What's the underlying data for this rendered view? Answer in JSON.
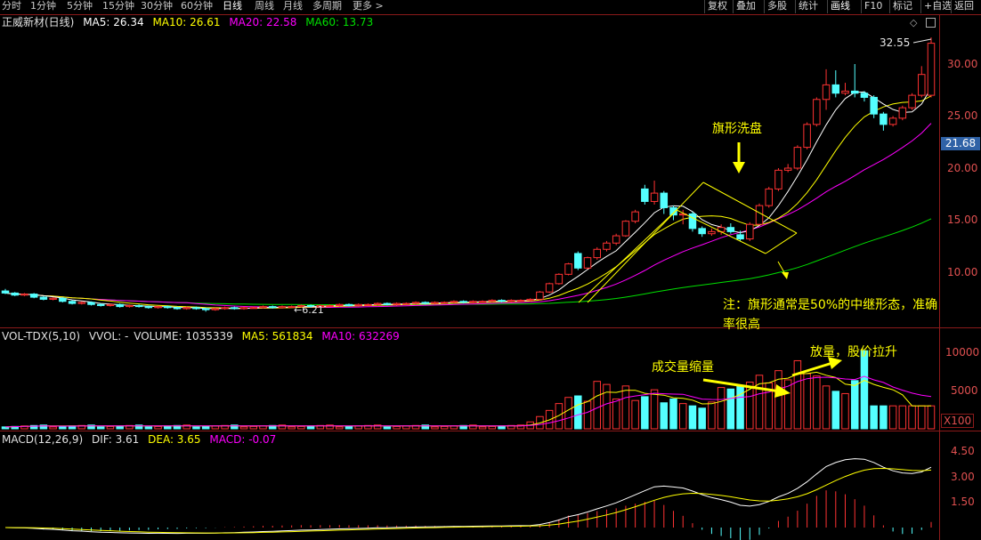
{
  "toolbar": {
    "periods": [
      "分时",
      "1分钟",
      "5分钟",
      "15分钟",
      "30分钟",
      "60分钟",
      "日线",
      "周线",
      "月线",
      "多周期",
      "更多 >"
    ],
    "active_period": "日线",
    "right_buttons": [
      "复权",
      "叠加",
      "多股",
      "统计",
      "画线",
      "F10",
      "标记",
      "+自选",
      "返回"
    ],
    "active_right": "画线"
  },
  "main_legend": {
    "title": "正威新材(日线)",
    "ma5": "MA5: 26.34",
    "ma10": "MA10: 26.61",
    "ma20": "MA20: 22.58",
    "ma60": "MA60: 13.73"
  },
  "price_axis": {
    "ticks": [
      "30.00",
      "25.00",
      "20.00",
      "15.00",
      "10.00"
    ],
    "current_price": "21.68",
    "high_label": "32.55",
    "low_label": "6.21"
  },
  "vol_legend": {
    "title": "VOL-TDX(5,10)",
    "vvol": "VVOL: -",
    "volume": "VOLUME: 1035339",
    "ma5": "MA5: 561834",
    "ma10": "MA10: 632269"
  },
  "vol_axis": {
    "ticks": [
      "10000",
      "5000"
    ],
    "unit": "X100"
  },
  "macd_legend": {
    "title": "MACD(12,26,9)",
    "dif": "DIF: 3.61",
    "dea": "DEA: 3.65",
    "macd": "MACD: -0.07"
  },
  "macd_axis": {
    "ticks": [
      "4.50",
      "3.00",
      "1.50"
    ]
  },
  "annotations": {
    "flag_wash": "旗形洗盘",
    "note_line1": "注：旗形通常是50%的中继形态，准确",
    "note_line2": "率很高",
    "volume_shrink": "成交量缩量",
    "volume_up": "放量，股价拉升"
  },
  "colors": {
    "up": "#ff3232",
    "down": "#54ffff",
    "ma5": "#ffffff",
    "ma10": "#ffff00",
    "ma20": "#ff00ff",
    "ma60": "#00e000",
    "annotation": "#ffff00"
  },
  "chart_data": {
    "type": "candlestick",
    "price_ylim": [
      5,
      33
    ],
    "candles": [
      {
        "o": 8.2,
        "c": 8.0,
        "h": 8.4,
        "l": 7.9
      },
      {
        "o": 8.0,
        "c": 7.8,
        "h": 8.1,
        "l": 7.7
      },
      {
        "o": 7.8,
        "c": 7.9,
        "h": 8.0,
        "l": 7.7
      },
      {
        "o": 7.9,
        "c": 7.6,
        "h": 8.0,
        "l": 7.5
      },
      {
        "o": 7.6,
        "c": 7.4,
        "h": 7.7,
        "l": 7.3
      },
      {
        "o": 7.4,
        "c": 7.5,
        "h": 7.6,
        "l": 7.3
      },
      {
        "o": 7.5,
        "c": 7.2,
        "h": 7.6,
        "l": 7.1
      },
      {
        "o": 7.2,
        "c": 7.0,
        "h": 7.3,
        "l": 6.9
      },
      {
        "o": 7.0,
        "c": 7.1,
        "h": 7.2,
        "l": 6.9
      },
      {
        "o": 7.1,
        "c": 6.9,
        "h": 7.2,
        "l": 6.8
      },
      {
        "o": 6.9,
        "c": 6.8,
        "h": 7.0,
        "l": 6.7
      },
      {
        "o": 6.8,
        "c": 6.9,
        "h": 7.0,
        "l": 6.7
      },
      {
        "o": 6.9,
        "c": 6.7,
        "h": 7.0,
        "l": 6.6
      },
      {
        "o": 6.7,
        "c": 6.8,
        "h": 6.9,
        "l": 6.6
      },
      {
        "o": 6.8,
        "c": 6.7,
        "h": 6.9,
        "l": 6.6
      },
      {
        "o": 6.7,
        "c": 6.6,
        "h": 6.8,
        "l": 6.5
      },
      {
        "o": 6.6,
        "c": 6.7,
        "h": 6.8,
        "l": 6.5
      },
      {
        "o": 6.7,
        "c": 6.6,
        "h": 6.8,
        "l": 6.5
      },
      {
        "o": 6.6,
        "c": 6.5,
        "h": 6.7,
        "l": 6.4
      },
      {
        "o": 6.5,
        "c": 6.6,
        "h": 6.7,
        "l": 6.4
      },
      {
        "o": 6.6,
        "c": 6.5,
        "h": 6.7,
        "l": 6.4
      },
      {
        "o": 6.5,
        "c": 6.4,
        "h": 6.6,
        "l": 6.21
      },
      {
        "o": 6.4,
        "c": 6.5,
        "h": 6.6,
        "l": 6.3
      },
      {
        "o": 6.5,
        "c": 6.6,
        "h": 6.7,
        "l": 6.4
      },
      {
        "o": 6.6,
        "c": 6.5,
        "h": 6.7,
        "l": 6.4
      },
      {
        "o": 6.5,
        "c": 6.6,
        "h": 6.7,
        "l": 6.4
      },
      {
        "o": 6.6,
        "c": 6.6,
        "h": 6.7,
        "l": 6.5
      },
      {
        "o": 6.6,
        "c": 6.7,
        "h": 6.8,
        "l": 6.5
      },
      {
        "o": 6.7,
        "c": 6.6,
        "h": 6.8,
        "l": 6.5
      },
      {
        "o": 6.6,
        "c": 6.7,
        "h": 6.8,
        "l": 6.5
      },
      {
        "o": 6.7,
        "c": 6.7,
        "h": 6.8,
        "l": 6.6
      },
      {
        "o": 6.7,
        "c": 6.8,
        "h": 6.9,
        "l": 6.6
      },
      {
        "o": 6.8,
        "c": 6.7,
        "h": 6.9,
        "l": 6.6
      },
      {
        "o": 6.7,
        "c": 6.8,
        "h": 6.9,
        "l": 6.6
      },
      {
        "o": 6.8,
        "c": 6.8,
        "h": 6.9,
        "l": 6.7
      },
      {
        "o": 6.8,
        "c": 6.9,
        "h": 7.0,
        "l": 6.7
      },
      {
        "o": 6.9,
        "c": 6.8,
        "h": 7.0,
        "l": 6.7
      },
      {
        "o": 6.8,
        "c": 6.9,
        "h": 7.0,
        "l": 6.7
      },
      {
        "o": 6.9,
        "c": 6.9,
        "h": 7.0,
        "l": 6.8
      },
      {
        "o": 6.9,
        "c": 7.0,
        "h": 7.1,
        "l": 6.8
      },
      {
        "o": 7.0,
        "c": 6.9,
        "h": 7.1,
        "l": 6.8
      },
      {
        "o": 6.9,
        "c": 7.0,
        "h": 7.1,
        "l": 6.8
      },
      {
        "o": 7.0,
        "c": 7.0,
        "h": 7.1,
        "l": 6.9
      },
      {
        "o": 7.0,
        "c": 7.1,
        "h": 7.2,
        "l": 6.9
      },
      {
        "o": 7.1,
        "c": 7.0,
        "h": 7.2,
        "l": 6.9
      },
      {
        "o": 7.0,
        "c": 7.1,
        "h": 7.2,
        "l": 6.9
      },
      {
        "o": 7.1,
        "c": 7.1,
        "h": 7.2,
        "l": 7.0
      },
      {
        "o": 7.1,
        "c": 7.2,
        "h": 7.3,
        "l": 7.0
      },
      {
        "o": 7.2,
        "c": 7.1,
        "h": 7.3,
        "l": 7.0
      },
      {
        "o": 7.1,
        "c": 7.2,
        "h": 7.3,
        "l": 7.0
      },
      {
        "o": 7.2,
        "c": 7.2,
        "h": 7.3,
        "l": 7.1
      },
      {
        "o": 7.2,
        "c": 7.3,
        "h": 7.4,
        "l": 7.1
      },
      {
        "o": 7.3,
        "c": 7.2,
        "h": 7.4,
        "l": 7.1
      },
      {
        "o": 7.2,
        "c": 7.3,
        "h": 7.4,
        "l": 7.1
      },
      {
        "o": 7.3,
        "c": 7.3,
        "h": 7.4,
        "l": 7.2
      },
      {
        "o": 7.3,
        "c": 7.4,
        "h": 7.5,
        "l": 7.2
      },
      {
        "o": 7.4,
        "c": 8.1,
        "h": 8.2,
        "l": 7.3
      },
      {
        "o": 8.1,
        "c": 8.9,
        "h": 9.0,
        "l": 8.0
      },
      {
        "o": 8.9,
        "c": 9.8,
        "h": 9.9,
        "l": 8.8
      },
      {
        "o": 9.8,
        "c": 10.8,
        "h": 10.9,
        "l": 9.7
      },
      {
        "o": 11.8,
        "c": 10.4,
        "h": 12.0,
        "l": 10.2
      },
      {
        "o": 10.4,
        "c": 11.4,
        "h": 11.5,
        "l": 10.3
      },
      {
        "o": 11.4,
        "c": 12.2,
        "h": 12.4,
        "l": 11.2
      },
      {
        "o": 12.2,
        "c": 12.8,
        "h": 13.0,
        "l": 12.0
      },
      {
        "o": 12.8,
        "c": 13.5,
        "h": 13.7,
        "l": 12.6
      },
      {
        "o": 13.5,
        "c": 14.9,
        "h": 15.0,
        "l": 13.4
      },
      {
        "o": 14.9,
        "c": 15.8,
        "h": 16.0,
        "l": 14.7
      },
      {
        "o": 18.0,
        "c": 16.8,
        "h": 18.4,
        "l": 16.5
      },
      {
        "o": 16.8,
        "c": 17.6,
        "h": 18.8,
        "l": 16.5
      },
      {
        "o": 17.6,
        "c": 16.2,
        "h": 17.8,
        "l": 15.6
      },
      {
        "o": 16.2,
        "c": 15.5,
        "h": 16.4,
        "l": 15.0
      },
      {
        "o": 15.5,
        "c": 15.6,
        "h": 16.0,
        "l": 14.6
      },
      {
        "o": 15.6,
        "c": 14.2,
        "h": 15.8,
        "l": 13.9
      },
      {
        "o": 14.2,
        "c": 13.7,
        "h": 14.4,
        "l": 13.4
      },
      {
        "o": 13.7,
        "c": 13.9,
        "h": 14.2,
        "l": 13.5
      },
      {
        "o": 13.9,
        "c": 14.3,
        "h": 14.6,
        "l": 13.6
      },
      {
        "o": 14.3,
        "c": 13.9,
        "h": 14.7,
        "l": 13.7
      },
      {
        "o": 13.6,
        "c": 13.2,
        "h": 14.0,
        "l": 13.0
      },
      {
        "o": 13.2,
        "c": 14.6,
        "h": 14.8,
        "l": 13.0
      },
      {
        "o": 14.6,
        "c": 16.4,
        "h": 16.6,
        "l": 14.5
      },
      {
        "o": 16.4,
        "c": 18.0,
        "h": 18.2,
        "l": 16.2
      },
      {
        "o": 18.0,
        "c": 19.8,
        "h": 20.0,
        "l": 17.8
      },
      {
        "o": 19.8,
        "c": 20.0,
        "h": 20.4,
        "l": 19.6
      },
      {
        "o": 20.0,
        "c": 22.0,
        "h": 22.2,
        "l": 19.8
      },
      {
        "o": 22.0,
        "c": 24.2,
        "h": 24.4,
        "l": 21.8
      },
      {
        "o": 24.2,
        "c": 26.6,
        "h": 26.8,
        "l": 24.0
      },
      {
        "o": 26.6,
        "c": 28.0,
        "h": 29.5,
        "l": 25.6
      },
      {
        "o": 28.0,
        "c": 27.2,
        "h": 29.4,
        "l": 26.8
      },
      {
        "o": 27.2,
        "c": 27.4,
        "h": 28.2,
        "l": 27.0
      },
      {
        "o": 27.4,
        "c": 27.2,
        "h": 30.0,
        "l": 26.8
      },
      {
        "o": 27.2,
        "c": 26.8,
        "h": 27.4,
        "l": 26.4
      },
      {
        "o": 26.8,
        "c": 25.2,
        "h": 27.0,
        "l": 24.8
      },
      {
        "o": 25.2,
        "c": 24.2,
        "h": 25.4,
        "l": 23.6
      },
      {
        "o": 24.2,
        "c": 24.8,
        "h": 25.0,
        "l": 24.0
      },
      {
        "o": 24.8,
        "c": 25.8,
        "h": 26.0,
        "l": 24.6
      },
      {
        "o": 25.8,
        "c": 27.0,
        "h": 27.2,
        "l": 25.6
      },
      {
        "o": 27.0,
        "c": 29.0,
        "h": 29.8,
        "l": 26.8
      },
      {
        "o": 27.0,
        "c": 32.0,
        "h": 32.55,
        "l": 26.8
      }
    ]
  }
}
